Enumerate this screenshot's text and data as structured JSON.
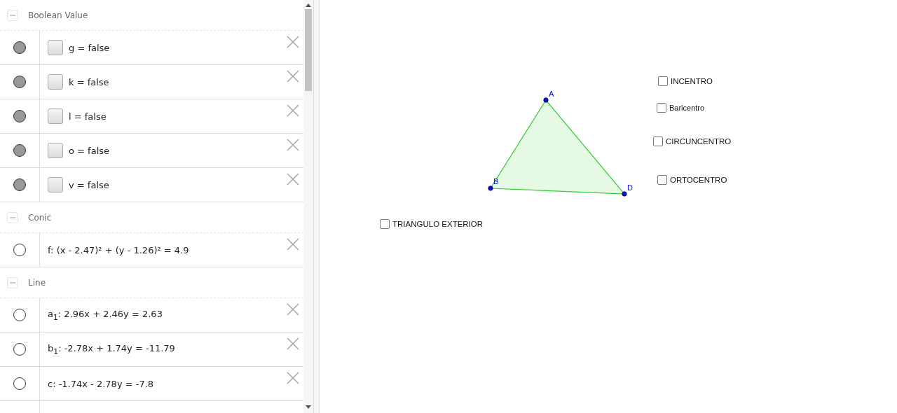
{
  "algebra": {
    "groups": [
      {
        "title": "Boolean Value",
        "expanded": true,
        "items": [
          {
            "kind": "boolean",
            "text": "g = false",
            "shown": true,
            "checked": false
          },
          {
            "kind": "boolean",
            "text": "k = false",
            "shown": true,
            "checked": false
          },
          {
            "kind": "boolean",
            "text": "l = false",
            "shown": true,
            "checked": false
          },
          {
            "kind": "boolean",
            "text": "o = false",
            "shown": true,
            "checked": false
          },
          {
            "kind": "boolean",
            "text": "v = false",
            "shown": true,
            "checked": false
          }
        ]
      },
      {
        "title": "Conic",
        "expanded": true,
        "items": [
          {
            "kind": "equation",
            "text": "f: (x - 2.47)² + (y - 1.26)² = 4.9",
            "shown": false
          }
        ]
      },
      {
        "title": "Line",
        "expanded": true,
        "items": [
          {
            "kind": "equation",
            "text": "a$_{1}$: 2.96x + 2.46y = 2.63",
            "shown": false
          },
          {
            "kind": "equation",
            "text": "b$_{1}$: -2.78x + 1.74y = -11.79",
            "shown": false
          },
          {
            "kind": "equation",
            "text": "c: -1.74x - 2.78y = -7.8",
            "shown": false
          }
        ]
      }
    ]
  },
  "graphics": {
    "points": [
      {
        "label": "A"
      },
      {
        "label": "B"
      },
      {
        "label": "D"
      }
    ],
    "checkboxes": [
      {
        "label": "INCENTRO",
        "checked": false
      },
      {
        "label": "Baricentro",
        "checked": false
      },
      {
        "label": "CIRCUNCENTRO",
        "checked": false
      },
      {
        "label": "ORTOCENTRO",
        "checked": false
      },
      {
        "label": "TRIANGULO EXTERIOR",
        "checked": false
      }
    ]
  }
}
